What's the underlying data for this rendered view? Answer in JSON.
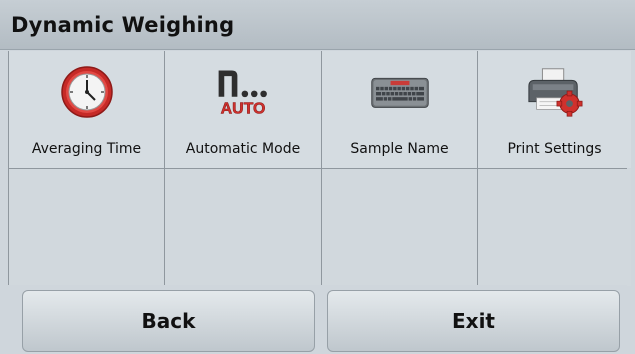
{
  "header": {
    "title": "Dynamic Weighing"
  },
  "menu": {
    "items": [
      {
        "label": "Averaging Time",
        "icon": "clock-icon"
      },
      {
        "label": "Automatic Mode",
        "icon": "auto-mode-icon",
        "icon_text": "AUTO"
      },
      {
        "label": "Sample Name",
        "icon": "keyboard-icon"
      },
      {
        "label": "Print Settings",
        "icon": "printer-settings-icon"
      }
    ]
  },
  "footer": {
    "back_label": "Back",
    "exit_label": "Exit"
  },
  "colors": {
    "accent_red": "#d0312d",
    "background": "#cfd6dc",
    "title_bar": "#bcc4ca"
  }
}
